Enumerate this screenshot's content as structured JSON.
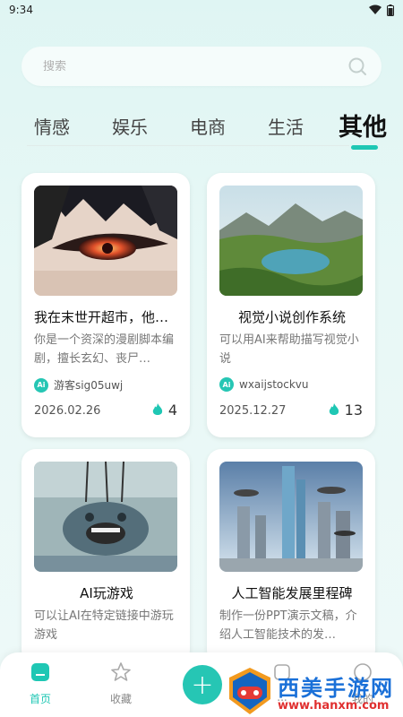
{
  "status_bar": {
    "time": "9:34"
  },
  "search": {
    "placeholder": "搜索"
  },
  "tabs": [
    {
      "label": "情感"
    },
    {
      "label": "娱乐"
    },
    {
      "label": "电商"
    },
    {
      "label": "生活"
    },
    {
      "label": "其他",
      "active": true
    }
  ],
  "cards": [
    {
      "title": "我在末世开超市，他…",
      "description": "你是一个资深的漫剧脚本编剧，擅长玄幻、丧尸…",
      "author": "游客sig05uwj",
      "date": "2026.02.26",
      "hot": "4",
      "image": "anime-eye-image"
    },
    {
      "title": "视觉小说创作系统",
      "description": "可以用AI来帮助描写视觉小说",
      "author": "wxaijstockvu",
      "date": "2025.12.27",
      "hot": "13",
      "image": "landscape-lake-image"
    },
    {
      "title": "AI玩游戏",
      "description": "可以让AI在特定链接中游玩游戏",
      "image": "creature-water-image"
    },
    {
      "title": "人工智能发展里程碑",
      "description": "制作一份PPT演示文稿，介绍人工智能技术的发…",
      "image": "futuristic-city-image"
    }
  ],
  "ai_badge": "Ai",
  "bottom_nav": {
    "home": "首页",
    "favorites": "收藏",
    "third": "...",
    "mine": "我的"
  },
  "watermark": {
    "text": "西美手游网",
    "url": "www.hanxm.com"
  },
  "colors": {
    "accent": "#1fc7b4",
    "background": "#e3f6f4",
    "hot": "#1fc7b4"
  }
}
